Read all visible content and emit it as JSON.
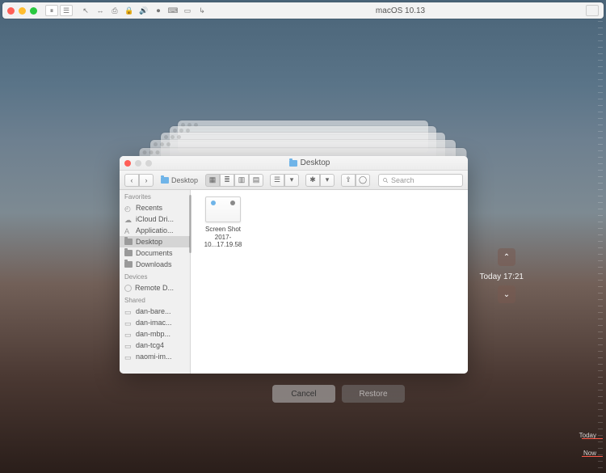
{
  "host": {
    "title": "macOS 10.13"
  },
  "timeline": {
    "today_label": "Today",
    "now_label": "Now",
    "current": "Today 17:21"
  },
  "finder": {
    "title": "Desktop",
    "path_label": "Desktop",
    "search_placeholder": "Search",
    "sidebar": {
      "favorites_header": "Favorites",
      "favorites": [
        {
          "label": "Recents"
        },
        {
          "label": "iCloud Dri..."
        },
        {
          "label": "Applicatio..."
        },
        {
          "label": "Desktop",
          "selected": true
        },
        {
          "label": "Documents"
        },
        {
          "label": "Downloads"
        }
      ],
      "devices_header": "Devices",
      "devices": [
        {
          "label": "Remote D..."
        }
      ],
      "shared_header": "Shared",
      "shared": [
        {
          "label": "dan-bare..."
        },
        {
          "label": "dan-imac..."
        },
        {
          "label": "dan-mbp..."
        },
        {
          "label": "dan-tcg4"
        },
        {
          "label": "naomi-im..."
        }
      ]
    },
    "files": [
      {
        "name_line1": "Screen Shot",
        "name_line2": "2017-10...17.19.58"
      }
    ]
  },
  "buttons": {
    "cancel": "Cancel",
    "restore": "Restore"
  }
}
